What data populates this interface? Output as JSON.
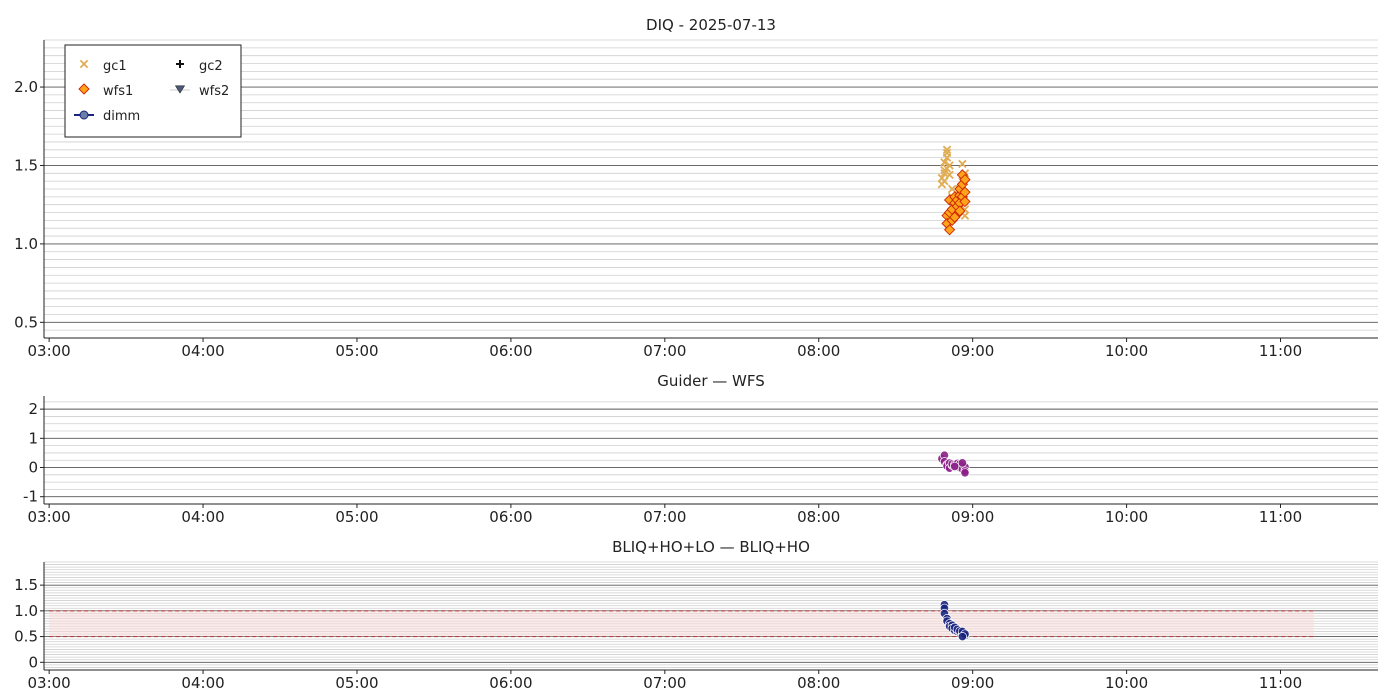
{
  "chart_data": [
    {
      "type": "scatter",
      "title": "DIQ - 2025-07-13",
      "xlabel": "",
      "ylabel": "",
      "xlim": [
        "02:58",
        "11:38"
      ],
      "ylim": [
        0.4,
        2.3
      ],
      "x_ticks": [
        "03:00",
        "04:00",
        "05:00",
        "06:00",
        "07:00",
        "08:00",
        "09:00",
        "10:00",
        "11:00"
      ],
      "y_ticks": [
        "0.5",
        "1.0",
        "1.5",
        "2.0"
      ],
      "grid": true,
      "legend": {
        "placement": "top-left",
        "entries": [
          {
            "name": "gc1",
            "marker": "x",
            "color": "#e0ad55"
          },
          {
            "name": "gc2",
            "marker": "plus",
            "color": "#111111"
          },
          {
            "name": "wfs1",
            "marker": "diamond",
            "color": "#ffa31a",
            "edge": "#cc2200"
          },
          {
            "name": "wfs2",
            "marker": "triangle-down",
            "color": "#4a5a78"
          },
          {
            "name": "dimm",
            "marker": "circle-line",
            "color": "#6a7fa8",
            "edge": "#1a237e"
          }
        ]
      },
      "series": [
        {
          "name": "gc1",
          "marker": "x",
          "color": "#e0ad55",
          "points": [
            [
              "08:48",
              1.38
            ],
            [
              "08:48",
              1.42
            ],
            [
              "08:49",
              1.45
            ],
            [
              "08:49",
              1.47
            ],
            [
              "08:49",
              1.52
            ],
            [
              "08:50",
              1.55
            ],
            [
              "08:50",
              1.58
            ],
            [
              "08:50",
              1.6
            ],
            [
              "08:50",
              1.48
            ],
            [
              "08:51",
              1.44
            ],
            [
              "08:51",
              1.5
            ],
            [
              "08:49",
              1.4
            ],
            [
              "08:52",
              1.35
            ],
            [
              "08:52",
              1.3
            ],
            [
              "08:53",
              1.27
            ],
            [
              "08:53",
              1.22
            ],
            [
              "08:54",
              1.25
            ],
            [
              "08:54",
              1.2
            ],
            [
              "08:55",
              1.3
            ],
            [
              "08:55",
              1.35
            ],
            [
              "08:56",
              1.4
            ],
            [
              "08:56",
              1.51
            ],
            [
              "08:57",
              1.45
            ],
            [
              "08:57",
              1.22
            ],
            [
              "08:57",
              1.18
            ]
          ]
        },
        {
          "name": "wfs1",
          "marker": "diamond",
          "color": "#ffa31a",
          "edge": "#cc2200",
          "points": [
            [
              "08:50",
              1.18
            ],
            [
              "08:50",
              1.13
            ],
            [
              "08:51",
              1.09
            ],
            [
              "08:51",
              1.2
            ],
            [
              "08:51",
              1.28
            ],
            [
              "08:52",
              1.15
            ],
            [
              "08:52",
              1.22
            ],
            [
              "08:53",
              1.26
            ],
            [
              "08:53",
              1.3
            ],
            [
              "08:54",
              1.19
            ],
            [
              "08:54",
              1.24
            ],
            [
              "08:54",
              1.28
            ],
            [
              "08:55",
              1.31
            ],
            [
              "08:55",
              1.26
            ],
            [
              "08:55",
              1.35
            ],
            [
              "08:56",
              1.3
            ],
            [
              "08:56",
              1.38
            ],
            [
              "08:56",
              1.44
            ],
            [
              "08:57",
              1.41
            ],
            [
              "08:57",
              1.33
            ],
            [
              "08:57",
              1.27
            ],
            [
              "08:55",
              1.21
            ],
            [
              "08:53",
              1.17
            ]
          ]
        }
      ]
    },
    {
      "type": "scatter",
      "title": "Guider — WFS",
      "xlabel": "",
      "ylabel": "",
      "xlim": [
        "02:58",
        "11:38"
      ],
      "ylim": [
        -1.25,
        2.45
      ],
      "x_ticks": [
        "03:00",
        "04:00",
        "05:00",
        "06:00",
        "07:00",
        "08:00",
        "09:00",
        "10:00",
        "11:00"
      ],
      "y_ticks": [
        "-1",
        "0",
        "1",
        "2"
      ],
      "grid": true,
      "series": [
        {
          "name": "",
          "marker": "circle",
          "color": "#8a1f87",
          "points": [
            [
              "08:48",
              0.3
            ],
            [
              "08:49",
              0.42
            ],
            [
              "08:49",
              0.2
            ],
            [
              "08:50",
              0.1
            ],
            [
              "08:50",
              0.05
            ],
            [
              "08:51",
              0.15
            ],
            [
              "08:51",
              -0.02
            ],
            [
              "08:52",
              0.08
            ],
            [
              "08:52",
              0.12
            ],
            [
              "08:53",
              0.02
            ],
            [
              "08:53",
              0.1
            ],
            [
              "08:54",
              0.05
            ],
            [
              "08:54",
              0.14
            ],
            [
              "08:55",
              0.0
            ],
            [
              "08:55",
              0.12
            ],
            [
              "08:56",
              0.06
            ],
            [
              "08:56",
              -0.05
            ],
            [
              "08:57",
              0.02
            ],
            [
              "08:57",
              -0.12
            ],
            [
              "08:57",
              -0.18
            ],
            [
              "08:56",
              0.16
            ],
            [
              "08:53",
              0.04
            ]
          ]
        }
      ]
    },
    {
      "type": "scatter",
      "title": "BLIQ+HO+LO — BLIQ+HO",
      "xlabel": "",
      "ylabel": "",
      "xlim": [
        "02:58",
        "11:38"
      ],
      "ylim": [
        -0.15,
        1.95
      ],
      "x_ticks": [
        "03:00",
        "04:00",
        "05:00",
        "06:00",
        "07:00",
        "08:00",
        "09:00",
        "10:00",
        "11:00"
      ],
      "y_ticks": [
        "0",
        "0.5",
        "1.0",
        "1.5"
      ],
      "grid": true,
      "band": {
        "from": 0.5,
        "to": 1.0,
        "x_from": "03:00",
        "x_to": "11:13",
        "color": "#f7dada",
        "line_color": "#b03030"
      },
      "series": [
        {
          "name": "",
          "marker": "circle",
          "color": "#1a237e",
          "points": [
            [
              "08:49",
              1.12
            ],
            [
              "08:49",
              1.05
            ],
            [
              "08:49",
              0.95
            ],
            [
              "08:50",
              0.85
            ],
            [
              "08:50",
              0.8
            ],
            [
              "08:51",
              0.75
            ],
            [
              "08:51",
              0.7
            ],
            [
              "08:52",
              0.72
            ],
            [
              "08:52",
              0.66
            ],
            [
              "08:53",
              0.62
            ],
            [
              "08:53",
              0.68
            ],
            [
              "08:54",
              0.6
            ],
            [
              "08:54",
              0.64
            ],
            [
              "08:55",
              0.58
            ],
            [
              "08:55",
              0.61
            ],
            [
              "08:56",
              0.56
            ],
            [
              "08:56",
              0.6
            ],
            [
              "08:57",
              0.52
            ],
            [
              "08:57",
              0.55
            ],
            [
              "08:56",
              0.5
            ]
          ]
        }
      ]
    }
  ]
}
